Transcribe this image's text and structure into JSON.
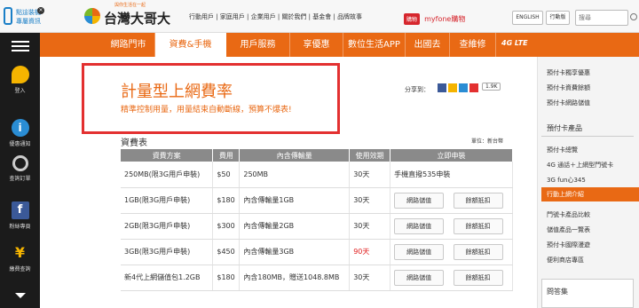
{
  "top": {
    "app_line1": "點這裝機",
    "app_line2": "專屬資訊",
    "slogan": "與你生活在一起",
    "brand": "台灣大哥大",
    "links": [
      "行動用戶",
      "家庭用戶",
      "企業用戶",
      "關於我們",
      "基金會",
      "品牌故事"
    ],
    "myfone_badge": "購物",
    "myfone": "myfone購物",
    "english": "ENGLISH",
    "mobile_btn": "行動版",
    "search_placeholder": "搜尋"
  },
  "sidebar": {
    "login": "登入",
    "notify": "優惠通知",
    "order": "查詢訂單",
    "fans": "粉絲專頁",
    "bill": "繳費查詢"
  },
  "nav": {
    "items": [
      "網路門市",
      "資費&手機",
      "用戶服務",
      "享優惠",
      "數位生活APP",
      "出國去",
      "查維修"
    ],
    "logo": "4G LTE"
  },
  "content": {
    "title": "計量型上網費率",
    "subtitle": "精準控制用量，用量結束自動斷線，預算不爆表!",
    "share_label": "分享到：",
    "share_count": "1.9K",
    "table_title": "資費表",
    "unit": "單位：新台幣",
    "headers": [
      "資費方案",
      "費用",
      "內含傳輸量",
      "使用效期",
      "立即申裝"
    ],
    "rows": [
      {
        "plan": "250MB(限3G用戶申裝)",
        "fee": "$50",
        "volume": "250MB",
        "days": "30天",
        "apply": "手機直撥535申裝",
        "btn1": "",
        "btn2": ""
      },
      {
        "plan": "1GB(限3G用戶申裝)",
        "fee": "$180",
        "volume": "內含傳輸量1GB",
        "days": "30天",
        "apply": "",
        "btn1": "網路儲值",
        "btn2": "餘額抵扣"
      },
      {
        "plan": "2GB(限3G用戶申裝)",
        "fee": "$300",
        "volume": "內含傳輸量2GB",
        "days": "30天",
        "apply": "",
        "btn1": "網路儲值",
        "btn2": "餘額抵扣"
      },
      {
        "plan": "3GB(限3G用戶申裝)",
        "fee": "$450",
        "volume": "內含傳輸量3GB",
        "days": "90天",
        "apply": "",
        "btn1": "網路儲值",
        "btn2": "餘額抵扣"
      },
      {
        "plan": "新4代上網儲值包1.2GB",
        "fee": "$180",
        "volume": "內含180MB，贈送1048.8MB",
        "days": "30天",
        "apply": "",
        "btn1": "網路儲值",
        "btn2": "餘額抵扣"
      }
    ]
  },
  "right": {
    "links_top": [
      "預付卡獨享優惠",
      "預付卡資費餘額",
      "預付卡網路儲值"
    ],
    "section": "預付卡產品",
    "links": [
      "預付卡總覽",
      "4G 通話＋上網型門號卡",
      "3G fun心345",
      "行動上網介紹",
      "門號卡產品比較",
      "儲值產品一覽表",
      "預付卡國際漫遊",
      "便利商店專區"
    ],
    "faq": "問答集"
  },
  "colors": {
    "accent": "#e96914",
    "sidebar": "#1b1b1b",
    "highlight": "#e33030",
    "days_red": "#e01e1e"
  }
}
